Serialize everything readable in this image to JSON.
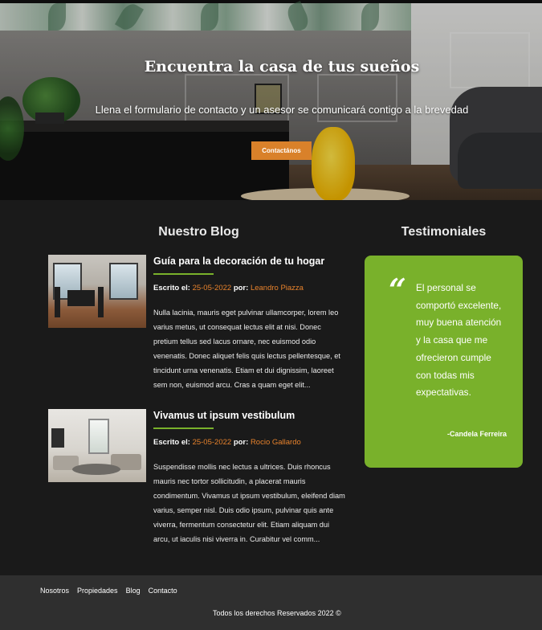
{
  "hero": {
    "title": "Encuentra la casa de tus sueños",
    "subtitle": "Llena el formulario de contacto y un asesor se comunicará contigo a la brevedad",
    "button_label": "Contactános"
  },
  "blog": {
    "heading": "Nuestro Blog",
    "meta_written_label": "Escrito el:",
    "meta_by_label": "por:",
    "posts": [
      {
        "title": "Guía para la decoración de tu hogar",
        "date": "25-05-2022",
        "author": "Leandro Piazza",
        "excerpt": "Nulla lacinia, mauris eget pulvinar ullamcorper, lorem leo varius metus, ut consequat lectus elit at nisi. Donec pretium tellus sed lacus ornare, nec euismod odio venenatis. Donec aliquet felis quis lectus pellentesque, et tincidunt urna venenatis. Etiam et dui dignissim, laoreet sem non, euismod arcu. Cras a quam eget elit..."
      },
      {
        "title": "Vivamus ut ipsum vestibulum",
        "date": "25-05-2022",
        "author": "Rocio Gallardo",
        "excerpt": "Suspendisse mollis nec lectus a ultrices. Duis rhoncus mauris nec tortor sollicitudin, a placerat mauris condimentum. Vivamus ut ipsum vestibulum, eleifend diam varius, semper nisl. Duis odio ipsum, pulvinar quis ante viverra, fermentum consectetur elit. Etiam aliquam dui arcu, ut iaculis nisi viverra in. Curabitur vel comm..."
      }
    ]
  },
  "testimonials": {
    "heading": "Testimoniales",
    "quote_mark": "“",
    "quote": "El personal se comportó excelente, muy buena atención y la casa que me ofrecieron cumple con todas mis expectativas.",
    "author": "-Candela Ferreira"
  },
  "footer": {
    "nav": [
      "Nosotros",
      "Propiedades",
      "Blog",
      "Contacto"
    ],
    "copyright": "Todos los derechos Reservados 2022 ©"
  },
  "colors": {
    "accent_green": "#79b12b",
    "accent_orange": "#d9812a",
    "background": "#1a1a1a",
    "footer": "#2f2f2f"
  },
  "icons": {
    "quote": "quote-icon"
  }
}
